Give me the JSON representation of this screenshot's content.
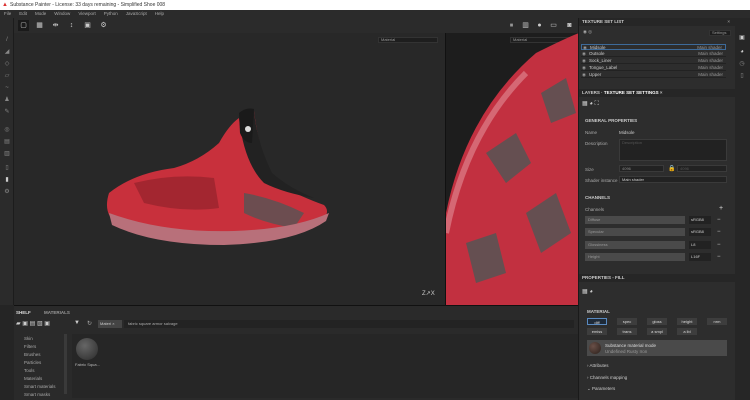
{
  "title": "Substance Painter - License: 33 days remaining - Simplified Shoe 008",
  "menu": [
    "File",
    "Edit",
    "Mode",
    "Window",
    "Viewport",
    "Python",
    "JavaScript",
    "Help"
  ],
  "viewport": {
    "left_mode": "Material",
    "right_mode": "Material",
    "axis_label": "Z X"
  },
  "texture_set_list": {
    "title": "TEXTURE SET LIST",
    "settings_label": "Settings",
    "items": [
      {
        "name": "Midsole",
        "shader": "Main shader"
      },
      {
        "name": "Outsole",
        "shader": "Main shader"
      },
      {
        "name": "Sock_Liner",
        "shader": "Main shader"
      },
      {
        "name": "Tongue_Label",
        "shader": "Main shader"
      },
      {
        "name": "Upper",
        "shader": "Main shader"
      }
    ]
  },
  "tabs": {
    "layers": "LAYERS",
    "tss": "TEXTURE SET SETTINGS"
  },
  "general": {
    "title": "GENERAL PROPERTIES",
    "name_label": "Name",
    "name_value": "Midsole",
    "desc_label": "Description",
    "desc_placeholder": "Description",
    "size_label": "Size",
    "size_value": "4096",
    "size_value2": "4096",
    "shader_label": "Shader instance",
    "shader_value": "Main shader"
  },
  "channels": {
    "title": "CHANNELS",
    "label": "Channels",
    "items": [
      {
        "name": "Diffuse",
        "format": "sRGB8"
      },
      {
        "name": "Specular",
        "format": "sRGB8"
      },
      {
        "name": "Glossiness",
        "format": "L8"
      },
      {
        "name": "Height",
        "format": "L16F"
      }
    ]
  },
  "properties": {
    "title": "PROPERTIES - FILL",
    "material_title": "MATERIAL",
    "buttons": [
      "diff",
      "spec",
      "gloss",
      "height",
      "nrm",
      "emiss",
      "trans",
      "a smpl",
      "a lbl"
    ],
    "material_name": "Substance material mode",
    "material_sub": "Undefined Rusty Iron",
    "sections": [
      "Attributes",
      "Channels mapping",
      "Parameters"
    ]
  },
  "shelf": {
    "tabs": [
      "SHELF",
      "MATERIALS"
    ],
    "filter_chip": "Materi",
    "search": "fabric square armor salvage",
    "categories": [
      "Skin",
      "Filters",
      "Brushes",
      "Particles",
      "Tools",
      "Materials",
      "Smart materials",
      "Smart masks"
    ],
    "asset": "Fabric Squa..."
  }
}
